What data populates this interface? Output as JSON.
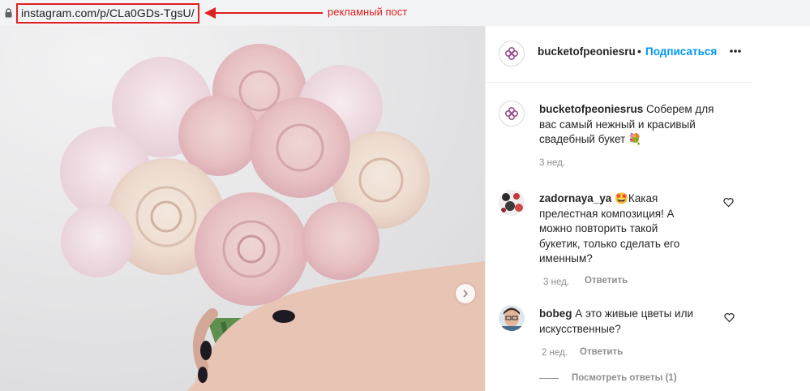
{
  "address_bar": {
    "url": "instagram.com/p/CLa0GDs-TgsU/",
    "annotation": "рекламный пост",
    "annotation_color": "#e02020"
  },
  "post": {
    "next_icon": "chevron-right-icon"
  },
  "header": {
    "username": "bucketofpeoniesru",
    "separator": "•",
    "follow_label": "Подписаться",
    "more_icon": "more-horizontal-icon"
  },
  "caption": {
    "username": "bucketofpeoniesrus",
    "text": " Соберем для вас самый нежный и красивый свадебный букет 💐",
    "time": "3 нед."
  },
  "comments": [
    {
      "username": "zadornaya_ya",
      "text": " 🤩Какая прелестная композиция! А можно повторить такой букетик, только сделать его именным?",
      "time": "3 нед.",
      "reply_label": "Ответить"
    },
    {
      "username": "bobeg",
      "text": " А это живые цветы или искусственные?",
      "time": "2 нед.",
      "reply_label": "Ответить",
      "view_replies": "Посмотреть ответы (1)"
    }
  ],
  "colors": {
    "follow_blue": "#0095f6",
    "muted_text": "#8e8e8e",
    "annotation_red": "#e02020"
  }
}
